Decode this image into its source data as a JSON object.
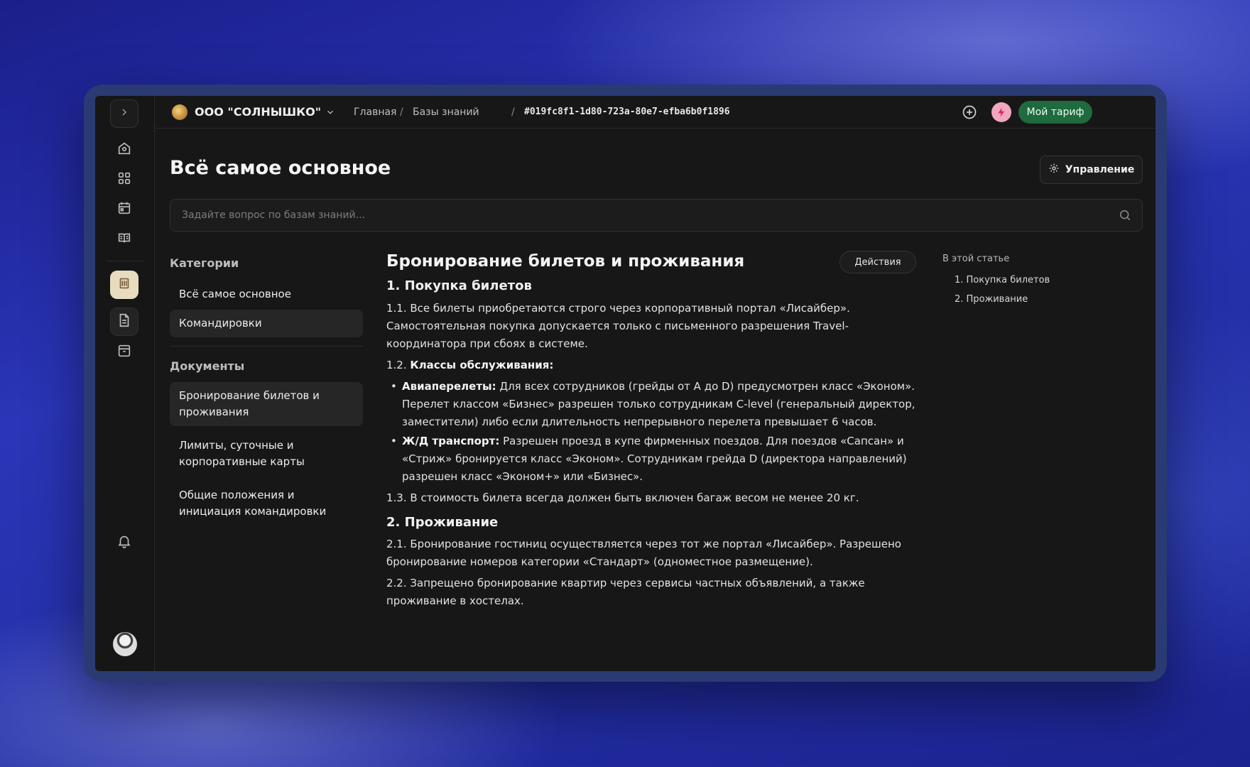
{
  "header": {
    "org_name": "ООО \"СОЛНЫШКО\"",
    "breadcrumbs": [
      "Главная",
      "Базы знаний"
    ],
    "separator": "/",
    "kb_id": "#019fc8f1-1d80-723a-80e7-efba6b0f1896",
    "plan_label": "Мой тариф",
    "plan_color": "#1f6a3e"
  },
  "page": {
    "title": "Всё самое основное",
    "manage_label": "Управление",
    "search_placeholder": "Задайте вопрос по базам знаний..."
  },
  "sidebar": {
    "categories_heading": "Категории",
    "categories": [
      "Всё самое основное",
      "Командировки"
    ],
    "documents_heading": "Документы",
    "documents": [
      "Бронирование билетов и проживания",
      "Лимиты, суточные и корпоративные карты",
      "Общие положения и инициация командировки"
    ]
  },
  "article": {
    "title": "Бронирование билетов и проживания",
    "actions_label": "Действия",
    "s1_title": "1. Покупка билетов",
    "p1_1": "1.1. Все билеты приобретаются строго через корпоративный портал «Лисайбер». Самостоятельная покупка допускается только с письменного разрешения Travel-координатора при сбоях в системе.",
    "p1_2_prefix": "1.2. ",
    "p1_2_bold": "Классы обслуживания:",
    "b1_bold": "Авиаперелеты:",
    "b1_text": " Для всех сотрудников (грейды от A до D) предусмотрен класс «Эконом». Перелет классом «Бизнес» разрешен только сотрудникам C-level (генеральный директор, заместители) либо если длительность непрерывного перелета превышает 6 часов.",
    "b2_bold": "Ж/Д транспорт:",
    "b2_text": " Разрешен проезд в купе фирменных поездов. Для поездов «Сапсан» и «Стриж» бронируется класс «Эконом». Сотрудникам грейда D (директора направлений) разрешен класс «Эконом+» или «Бизнес».",
    "p1_3": "1.3. В стоимость билета всегда должен быть включен багаж весом не менее 20 кг.",
    "s2_title": "2. Проживание",
    "p2_1": "2.1. Бронирование гостиниц осуществляется через тот же портал «Лисайбер». Разрешено бронирование номеров категории «Стандарт» (одноместное размещение).",
    "p2_2": "2.2. Запрещено бронирование квартир через сервисы частных объявлений, а также проживание в хостелах."
  },
  "toc": {
    "heading": "В этой статье",
    "items": [
      "1. Покупка билетов",
      "2. Проживание"
    ]
  },
  "icons": {
    "rail": [
      "chevron-right-icon",
      "home-icon",
      "grid-icon",
      "calendar-icon",
      "book-icon",
      "knowledge-base-icon",
      "document-icon",
      "archive-icon",
      "bell-icon"
    ],
    "bolt_color": "#e0236a"
  }
}
